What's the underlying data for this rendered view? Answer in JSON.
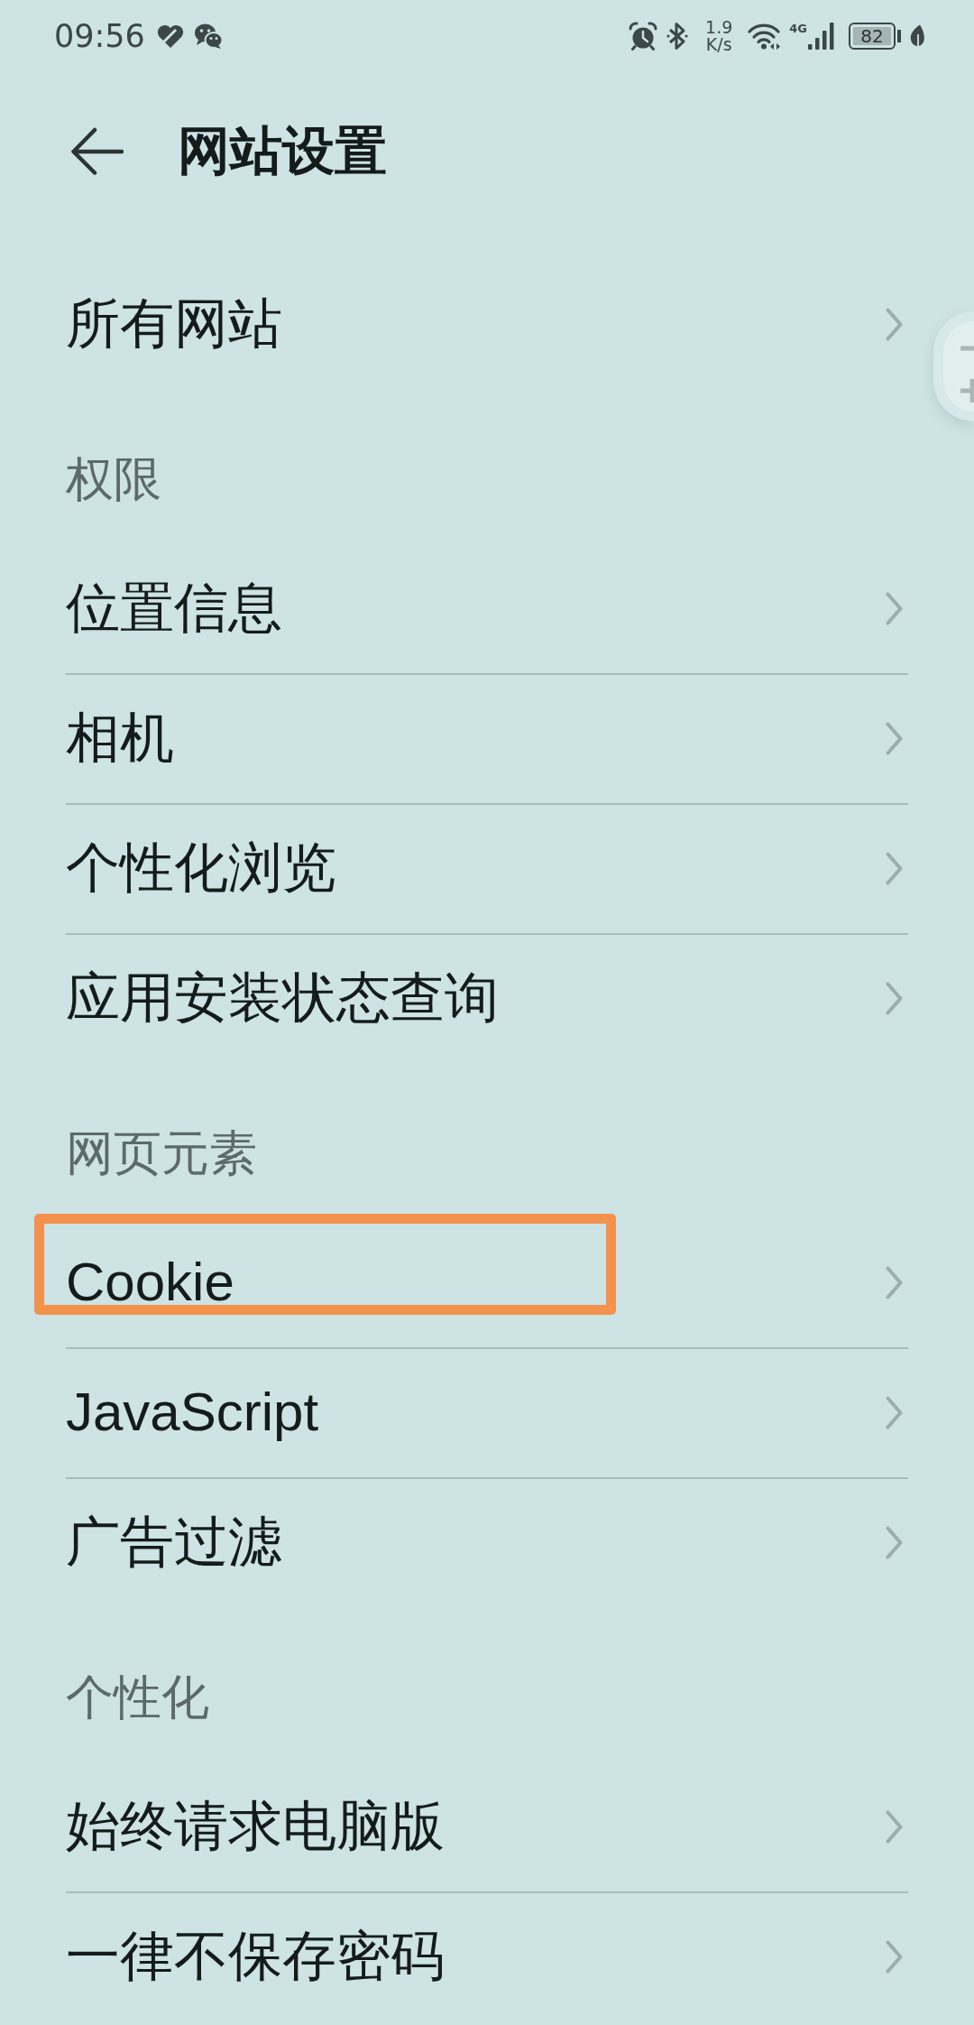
{
  "status_bar": {
    "time": "09:56",
    "network_speed_value": "1.9",
    "network_speed_unit": "K/s",
    "network_type": "4G",
    "battery": "82"
  },
  "header": {
    "title": "网站设置"
  },
  "items": [
    {
      "kind": "row",
      "label": "所有网站",
      "highlighted": false
    },
    {
      "kind": "section",
      "label": "权限"
    },
    {
      "kind": "row",
      "label": "位置信息",
      "highlighted": false
    },
    {
      "kind": "row",
      "label": "相机",
      "highlighted": false
    },
    {
      "kind": "row",
      "label": "个性化浏览",
      "highlighted": false
    },
    {
      "kind": "row",
      "label": "应用安装状态查询",
      "highlighted": false
    },
    {
      "kind": "section",
      "label": "网页元素"
    },
    {
      "kind": "row",
      "label": "Cookie",
      "highlighted": true
    },
    {
      "kind": "row",
      "label": "JavaScript",
      "highlighted": false
    },
    {
      "kind": "row",
      "label": "广告过滤",
      "highlighted": false
    },
    {
      "kind": "section",
      "label": "个性化"
    },
    {
      "kind": "row",
      "label": "始终请求电脑版",
      "highlighted": false
    },
    {
      "kind": "row",
      "label": "一律不保存密码",
      "highlighted": false
    }
  ]
}
